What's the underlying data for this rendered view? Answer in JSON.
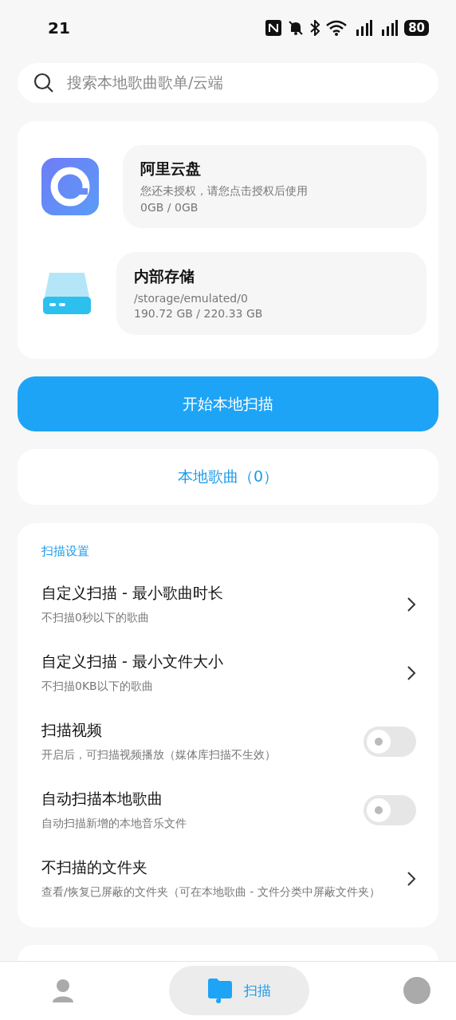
{
  "status_bar": {
    "time": "21",
    "battery": "80"
  },
  "search": {
    "placeholder": "搜索本地歌曲歌单/云端"
  },
  "storages": [
    {
      "kind": "cloud",
      "name": "阿里云盘",
      "lines": [
        "您还未授权，请您点击授权后使用",
        "0GB / 0GB"
      ]
    },
    {
      "kind": "disk",
      "name": "内部存储",
      "lines": [
        "/storage/emulated/0",
        "190.72 GB / 220.33 GB"
      ]
    }
  ],
  "scan_button": "开始本地扫描",
  "local_songs": "本地歌曲（0）",
  "settings": {
    "title": "扫描设置",
    "items": [
      {
        "kind": "arrow",
        "title": "自定义扫描 - 最小歌曲时长",
        "subtitle": "不扫描0秒以下的歌曲"
      },
      {
        "kind": "arrow",
        "title": "自定义扫描 - 最小文件大小",
        "subtitle": "不扫描0KB以下的歌曲"
      },
      {
        "kind": "switch",
        "title": "扫描视频",
        "subtitle": "开启后，可扫描视频播放（媒体库扫描不生效）",
        "on": false
      },
      {
        "kind": "switch",
        "title": "自动扫描本地歌曲",
        "subtitle": "自动扫描新增的本地音乐文件",
        "on": false
      },
      {
        "kind": "arrow",
        "title": "不扫描的文件夹",
        "subtitle": "查看/恢复已屏蔽的文件夹（可在本地歌曲 - 文件分类中屏蔽文件夹）"
      }
    ]
  },
  "bottom_nav": [
    {
      "kind": "profile",
      "selected": false
    },
    {
      "kind": "scan",
      "label": "扫描",
      "selected": true
    },
    {
      "kind": "other",
      "selected": false
    }
  ]
}
